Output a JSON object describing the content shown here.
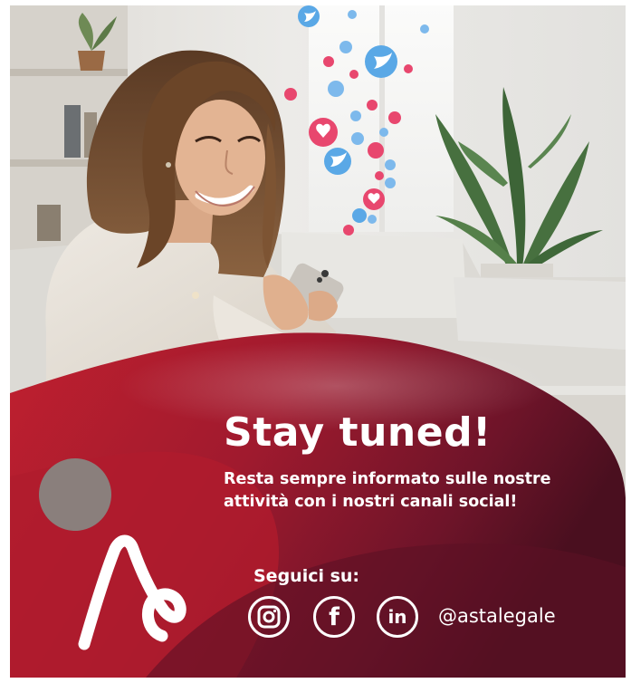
{
  "headline": "Stay tuned!",
  "subtitle": {
    "line1": "Resta sempre informato sulle nostre",
    "line2": "attività con i nostri canali social!"
  },
  "follow_label": "Seguici su:",
  "handle": "@astalegale",
  "social_icons": [
    "instagram-icon",
    "facebook-icon",
    "linkedin-icon"
  ],
  "facebook_glyph": "f",
  "linkedin_glyph": "in",
  "colors": {
    "brand_red": "#b31d2c",
    "brand_dark": "#4a0f1f",
    "twitter_bubble": "#5aa8e6",
    "heart_bubble": "#e8476e"
  }
}
